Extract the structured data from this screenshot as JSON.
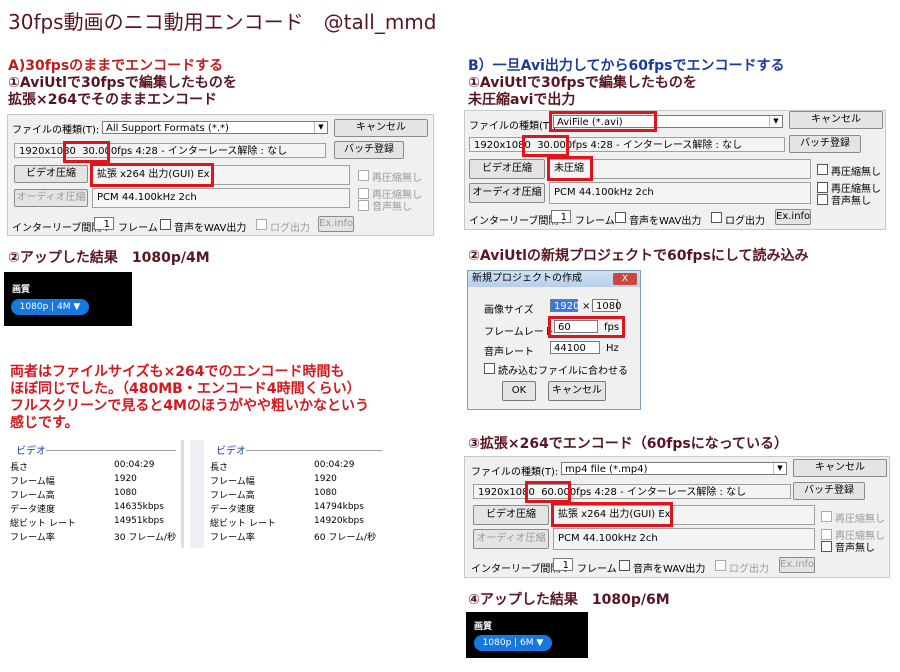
{
  "title": "30fps動画のニコ動用エンコード　@tall_mmd",
  "sectionA": {
    "heading": "A)30fpsのままでエンコードする",
    "line1": "①AviUtlで30fpsで編集したものを",
    "line2": "拡張×264でそのままエンコード",
    "dialog": {
      "file_type_label": "ファイルの種類(T):",
      "file_type_value": "All Support Formats (*.*)",
      "cancel": "キャンセル",
      "resolution": "1920x1080",
      "fps": "30.000fps",
      "duration_info": "4:28 - インターレース解除 : なし",
      "batch": "バッチ登録",
      "video_btn": "ビデオ圧縮",
      "video_codec": "拡張 x264 出力(GUI) Ex",
      "recompress_none": "再圧縮無し",
      "audio_btn": "オーディオ圧縮",
      "audio_codec": "PCM 44.100kHz 2ch",
      "recompress_none2": "再圧縮無し",
      "audio_none": "音声無し",
      "interleave_label": "インターリーブ間隔 :",
      "interleave_value": "1",
      "frame": "フレーム",
      "wav_output": "音声をWAV出力",
      "log_output": "ログ出力",
      "ex_info": "Ex.info"
    },
    "result_heading": "②アップした結果　1080p/4M",
    "quality": {
      "label": "画質",
      "value": "1080p | 4M ▼"
    }
  },
  "note": [
    "両者はファイルサイズも×264でのエンコード時間も",
    "ほぼ同じでした。（480MB・エンコード4時間くらい）",
    "フルスクリーンで見ると4Mのほうがやや粗いかなという",
    "感じです。"
  ],
  "info_left": {
    "header": "ビデオ",
    "rows": [
      {
        "k": "長さ",
        "v": "00:04:29"
      },
      {
        "k": "フレーム幅",
        "v": "1920"
      },
      {
        "k": "フレーム高",
        "v": "1080"
      },
      {
        "k": "データ速度",
        "v": "14635kbps"
      },
      {
        "k": "総ビット レート",
        "v": "14951kbps"
      },
      {
        "k": "フレーム率",
        "v": "30 フレーム/秒"
      }
    ]
  },
  "info_right": {
    "header": "ビデオ",
    "rows": [
      {
        "k": "長さ",
        "v": "00:04:29"
      },
      {
        "k": "フレーム幅",
        "v": "1920"
      },
      {
        "k": "フレーム高",
        "v": "1080"
      },
      {
        "k": "データ速度",
        "v": "14794kbps"
      },
      {
        "k": "総ビット レート",
        "v": "14920kbps"
      },
      {
        "k": "フレーム率",
        "v": "60 フレーム/秒"
      }
    ]
  },
  "sectionB": {
    "heading": "B）一旦Avi出力してから60fpsでエンコードする",
    "line1": "①AviUtlで30fpsで編集したものを",
    "line2": "未圧縮aviで出力",
    "dialog": {
      "file_type_label": "ファイルの種類(T):",
      "file_type_value": "AviFile (*.avi)",
      "cancel": "キャンセル",
      "resolution": "1920x1080",
      "fps": "30.000fps",
      "duration_info": "4:28 - インターレース解除 : なし",
      "batch": "バッチ登録",
      "video_btn": "ビデオ圧縮",
      "video_codec": "未圧縮",
      "recompress_none": "再圧縮無し",
      "audio_btn": "オーディオ圧縮",
      "audio_codec": "PCM 44.100kHz 2ch",
      "recompress_none2": "再圧縮無し",
      "audio_none": "音声無し",
      "interleave_label": "インターリーブ間隔 :",
      "interleave_value": "1",
      "frame": "フレーム",
      "wav_output": "音声をWAV出力",
      "log_output": "ログ出力",
      "ex_info": "Ex.info"
    },
    "step2_heading": "②AviUtlの新規プロジェクトで60fpsにして読み込み",
    "new_project": {
      "title": "新規プロジェクトの作成",
      "close": "X",
      "image_size_label": "画像サイズ",
      "width": "1920",
      "times": "×",
      "height": "1080",
      "frame_rate_label": "フレームレート",
      "frame_rate": "60",
      "fps_unit": "fps",
      "audio_rate_label": "音声レート",
      "audio_rate": "44100",
      "hz": "Hz",
      "match_file": "読み込むファイルに合わせる",
      "ok": "OK",
      "cancel": "キャンセル"
    },
    "step3_heading": "③拡張×264でエンコード（60fpsになっている）",
    "dialog3": {
      "file_type_label": "ファイルの種類(T):",
      "file_type_value": "mp4 file (*.mp4)",
      "cancel": "キャンセル",
      "resolution": "1920x1080",
      "fps": "60.000fps",
      "duration_info": "4:28 - インターレース解除 : なし",
      "batch": "バッチ登録",
      "video_btn": "ビデオ圧縮",
      "video_codec": "拡張 x264 出力(GUI) Ex",
      "recompress_none": "再圧縮無し",
      "audio_btn": "オーディオ圧縮",
      "audio_codec": "PCM 44.100kHz 2ch",
      "recompress_none2": "再圧縮無し",
      "audio_none": "音声無し",
      "interleave_label": "インターリーブ間隔 :",
      "interleave_value": "1",
      "frame": "フレーム",
      "wav_output": "音声をWAV出力",
      "log_output": "ログ出力",
      "ex_info": "Ex.info"
    },
    "step4_heading": "④アップした結果　1080p/6M",
    "quality": {
      "label": "画質",
      "value": "1080p | 6M ▼"
    }
  },
  "colors": {
    "highlight": "#e0141c",
    "title": "#5a1620",
    "heading_blue": "#1b3aa0",
    "note_red": "#d4181f",
    "badge_blue": "#1679e0"
  }
}
